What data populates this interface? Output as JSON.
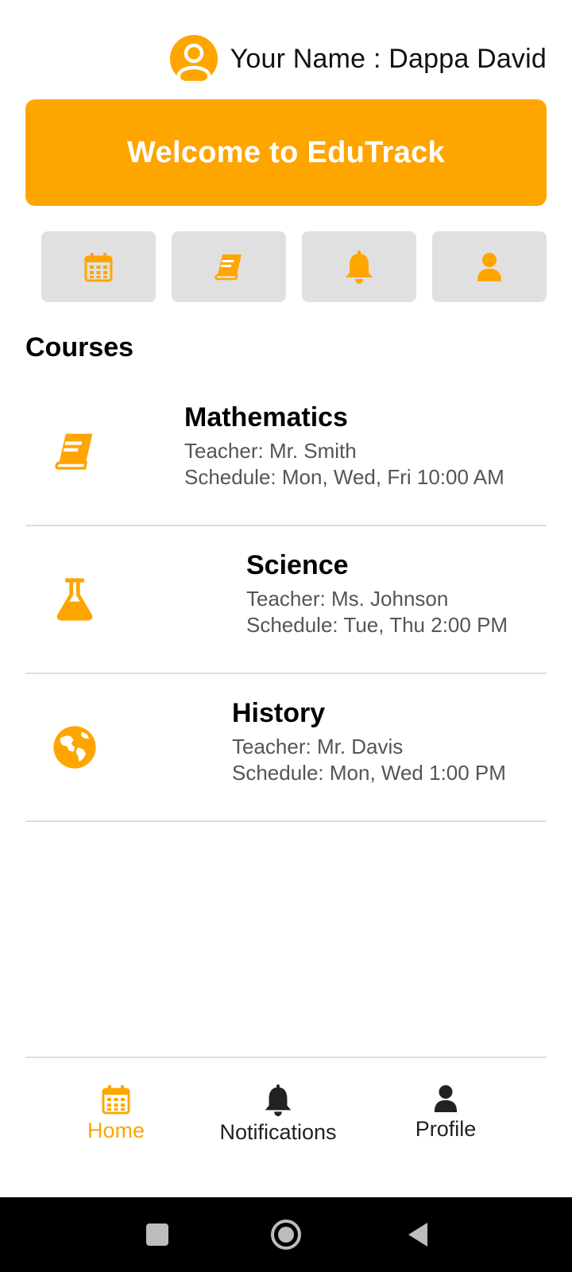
{
  "user": {
    "name_label": "Your Name : Dappa David",
    "avatar_icon": "user-circle-icon"
  },
  "banner": {
    "title": "Welcome to EduTrack"
  },
  "quick_actions": [
    {
      "icon": "calendar-icon"
    },
    {
      "icon": "book-icon"
    },
    {
      "icon": "bell-icon"
    },
    {
      "icon": "user-icon"
    }
  ],
  "courses_section": {
    "title": "Courses"
  },
  "courses": [
    {
      "name": "Mathematics",
      "teacher": "Teacher: Mr. Smith",
      "schedule": "Schedule: Mon, Wed, Fri 10:00 AM",
      "icon": "book-icon"
    },
    {
      "name": "Science",
      "teacher": "Teacher: Ms. Johnson",
      "schedule": "Schedule: Tue, Thu 2:00 PM",
      "icon": "flask-icon"
    },
    {
      "name": "History",
      "teacher": "Teacher: Mr. Davis",
      "schedule": "Schedule: Mon, Wed 1:00 PM",
      "icon": "globe-icon"
    }
  ],
  "bottom_nav": [
    {
      "label": "Home",
      "icon": "calendar-icon",
      "active": true
    },
    {
      "label": "Notifications",
      "icon": "bell-icon",
      "active": false
    },
    {
      "label": "Profile",
      "icon": "user-icon",
      "active": false
    }
  ],
  "colors": {
    "accent": "#FFA500",
    "tile_bg": "#E0E0E0",
    "divider": "#DDDDDD",
    "nav_inactive": "#222222"
  },
  "system_nav": [
    {
      "icon": "recents-square-icon"
    },
    {
      "icon": "home-circle-icon"
    },
    {
      "icon": "back-triangle-icon"
    }
  ]
}
